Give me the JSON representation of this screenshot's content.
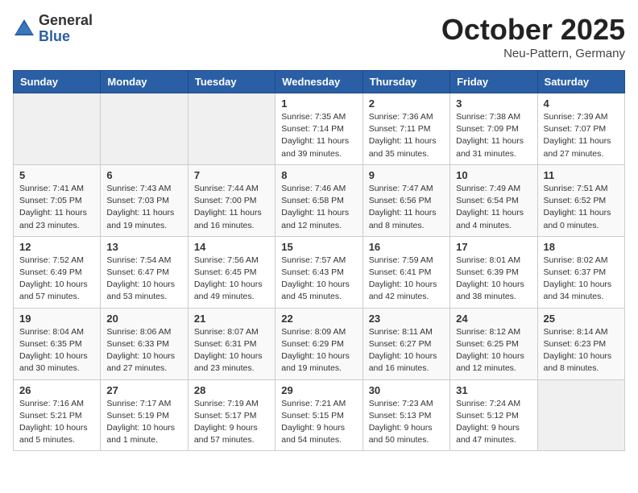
{
  "logo": {
    "general": "General",
    "blue": "Blue"
  },
  "header": {
    "month": "October 2025",
    "location": "Neu-Pattern, Germany"
  },
  "weekdays": [
    "Sunday",
    "Monday",
    "Tuesday",
    "Wednesday",
    "Thursday",
    "Friday",
    "Saturday"
  ],
  "weeks": [
    [
      {
        "day": "",
        "sunrise": "",
        "sunset": "",
        "daylight": ""
      },
      {
        "day": "",
        "sunrise": "",
        "sunset": "",
        "daylight": ""
      },
      {
        "day": "",
        "sunrise": "",
        "sunset": "",
        "daylight": ""
      },
      {
        "day": "1",
        "sunrise": "Sunrise: 7:35 AM",
        "sunset": "Sunset: 7:14 PM",
        "daylight": "Daylight: 11 hours and 39 minutes."
      },
      {
        "day": "2",
        "sunrise": "Sunrise: 7:36 AM",
        "sunset": "Sunset: 7:11 PM",
        "daylight": "Daylight: 11 hours and 35 minutes."
      },
      {
        "day": "3",
        "sunrise": "Sunrise: 7:38 AM",
        "sunset": "Sunset: 7:09 PM",
        "daylight": "Daylight: 11 hours and 31 minutes."
      },
      {
        "day": "4",
        "sunrise": "Sunrise: 7:39 AM",
        "sunset": "Sunset: 7:07 PM",
        "daylight": "Daylight: 11 hours and 27 minutes."
      }
    ],
    [
      {
        "day": "5",
        "sunrise": "Sunrise: 7:41 AM",
        "sunset": "Sunset: 7:05 PM",
        "daylight": "Daylight: 11 hours and 23 minutes."
      },
      {
        "day": "6",
        "sunrise": "Sunrise: 7:43 AM",
        "sunset": "Sunset: 7:03 PM",
        "daylight": "Daylight: 11 hours and 19 minutes."
      },
      {
        "day": "7",
        "sunrise": "Sunrise: 7:44 AM",
        "sunset": "Sunset: 7:00 PM",
        "daylight": "Daylight: 11 hours and 16 minutes."
      },
      {
        "day": "8",
        "sunrise": "Sunrise: 7:46 AM",
        "sunset": "Sunset: 6:58 PM",
        "daylight": "Daylight: 11 hours and 12 minutes."
      },
      {
        "day": "9",
        "sunrise": "Sunrise: 7:47 AM",
        "sunset": "Sunset: 6:56 PM",
        "daylight": "Daylight: 11 hours and 8 minutes."
      },
      {
        "day": "10",
        "sunrise": "Sunrise: 7:49 AM",
        "sunset": "Sunset: 6:54 PM",
        "daylight": "Daylight: 11 hours and 4 minutes."
      },
      {
        "day": "11",
        "sunrise": "Sunrise: 7:51 AM",
        "sunset": "Sunset: 6:52 PM",
        "daylight": "Daylight: 11 hours and 0 minutes."
      }
    ],
    [
      {
        "day": "12",
        "sunrise": "Sunrise: 7:52 AM",
        "sunset": "Sunset: 6:49 PM",
        "daylight": "Daylight: 10 hours and 57 minutes."
      },
      {
        "day": "13",
        "sunrise": "Sunrise: 7:54 AM",
        "sunset": "Sunset: 6:47 PM",
        "daylight": "Daylight: 10 hours and 53 minutes."
      },
      {
        "day": "14",
        "sunrise": "Sunrise: 7:56 AM",
        "sunset": "Sunset: 6:45 PM",
        "daylight": "Daylight: 10 hours and 49 minutes."
      },
      {
        "day": "15",
        "sunrise": "Sunrise: 7:57 AM",
        "sunset": "Sunset: 6:43 PM",
        "daylight": "Daylight: 10 hours and 45 minutes."
      },
      {
        "day": "16",
        "sunrise": "Sunrise: 7:59 AM",
        "sunset": "Sunset: 6:41 PM",
        "daylight": "Daylight: 10 hours and 42 minutes."
      },
      {
        "day": "17",
        "sunrise": "Sunrise: 8:01 AM",
        "sunset": "Sunset: 6:39 PM",
        "daylight": "Daylight: 10 hours and 38 minutes."
      },
      {
        "day": "18",
        "sunrise": "Sunrise: 8:02 AM",
        "sunset": "Sunset: 6:37 PM",
        "daylight": "Daylight: 10 hours and 34 minutes."
      }
    ],
    [
      {
        "day": "19",
        "sunrise": "Sunrise: 8:04 AM",
        "sunset": "Sunset: 6:35 PM",
        "daylight": "Daylight: 10 hours and 30 minutes."
      },
      {
        "day": "20",
        "sunrise": "Sunrise: 8:06 AM",
        "sunset": "Sunset: 6:33 PM",
        "daylight": "Daylight: 10 hours and 27 minutes."
      },
      {
        "day": "21",
        "sunrise": "Sunrise: 8:07 AM",
        "sunset": "Sunset: 6:31 PM",
        "daylight": "Daylight: 10 hours and 23 minutes."
      },
      {
        "day": "22",
        "sunrise": "Sunrise: 8:09 AM",
        "sunset": "Sunset: 6:29 PM",
        "daylight": "Daylight: 10 hours and 19 minutes."
      },
      {
        "day": "23",
        "sunrise": "Sunrise: 8:11 AM",
        "sunset": "Sunset: 6:27 PM",
        "daylight": "Daylight: 10 hours and 16 minutes."
      },
      {
        "day": "24",
        "sunrise": "Sunrise: 8:12 AM",
        "sunset": "Sunset: 6:25 PM",
        "daylight": "Daylight: 10 hours and 12 minutes."
      },
      {
        "day": "25",
        "sunrise": "Sunrise: 8:14 AM",
        "sunset": "Sunset: 6:23 PM",
        "daylight": "Daylight: 10 hours and 8 minutes."
      }
    ],
    [
      {
        "day": "26",
        "sunrise": "Sunrise: 7:16 AM",
        "sunset": "Sunset: 5:21 PM",
        "daylight": "Daylight: 10 hours and 5 minutes."
      },
      {
        "day": "27",
        "sunrise": "Sunrise: 7:17 AM",
        "sunset": "Sunset: 5:19 PM",
        "daylight": "Daylight: 10 hours and 1 minute."
      },
      {
        "day": "28",
        "sunrise": "Sunrise: 7:19 AM",
        "sunset": "Sunset: 5:17 PM",
        "daylight": "Daylight: 9 hours and 57 minutes."
      },
      {
        "day": "29",
        "sunrise": "Sunrise: 7:21 AM",
        "sunset": "Sunset: 5:15 PM",
        "daylight": "Daylight: 9 hours and 54 minutes."
      },
      {
        "day": "30",
        "sunrise": "Sunrise: 7:23 AM",
        "sunset": "Sunset: 5:13 PM",
        "daylight": "Daylight: 9 hours and 50 minutes."
      },
      {
        "day": "31",
        "sunrise": "Sunrise: 7:24 AM",
        "sunset": "Sunset: 5:12 PM",
        "daylight": "Daylight: 9 hours and 47 minutes."
      },
      {
        "day": "",
        "sunrise": "",
        "sunset": "",
        "daylight": ""
      }
    ]
  ]
}
